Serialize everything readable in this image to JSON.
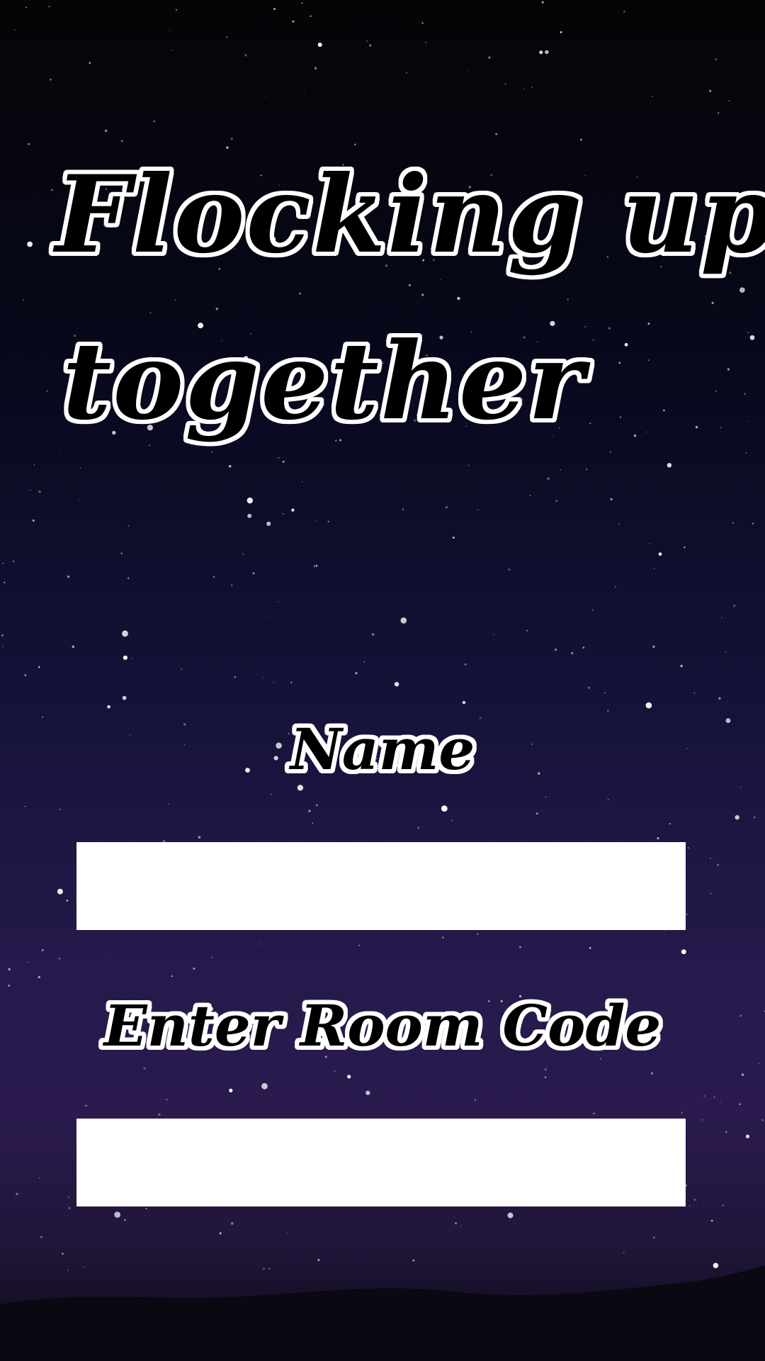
{
  "title": {
    "line1": "Flocking up",
    "line2": "together"
  },
  "form": {
    "name_label": "Name",
    "name_value": "",
    "room_label": "Enter Room Code",
    "room_value": ""
  },
  "colors": {
    "sky_top": "#050507",
    "sky_mid": "#0e0f2e",
    "sky_bottom": "#2a1a4e",
    "hills": "#0a0810",
    "field_bg": "#ffffff",
    "label_fill": "#000000",
    "label_outline": "#ffffff"
  }
}
